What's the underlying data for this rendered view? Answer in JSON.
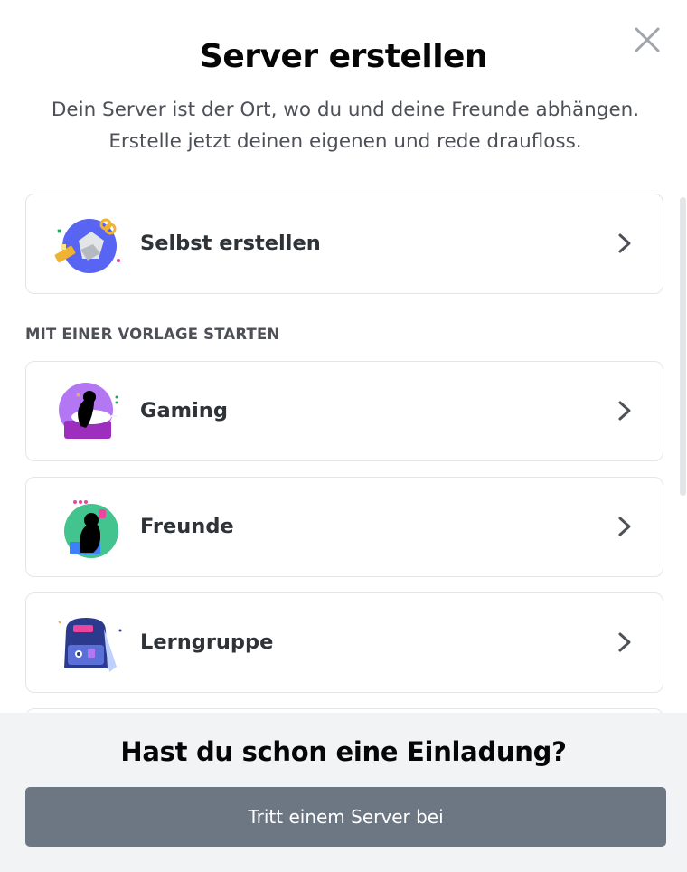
{
  "modal": {
    "title": "Server erstellen",
    "subtitle_line1": "Dein Server ist der Ort, wo du und deine Freunde abhängen.",
    "subtitle_line2": "Erstelle jetzt deinen eigenen und rede draufloss."
  },
  "options": [
    {
      "label": "Selbst erstellen",
      "icon": "create-own-icon"
    },
    {
      "label": "Gaming",
      "icon": "gaming-icon"
    },
    {
      "label": "Freunde",
      "icon": "friends-icon"
    },
    {
      "label": "Lerngruppe",
      "icon": "study-group-icon"
    }
  ],
  "template_section": {
    "title": "MIT EINER VORLAGE STARTEN"
  },
  "footer": {
    "title": "Hast du schon eine Einladung?",
    "join_label": "Tritt einem Server bei"
  },
  "colors": {
    "accent_button": "#6d7784",
    "footer_bg": "#f2f3f5",
    "border": "#e3e5e8"
  }
}
